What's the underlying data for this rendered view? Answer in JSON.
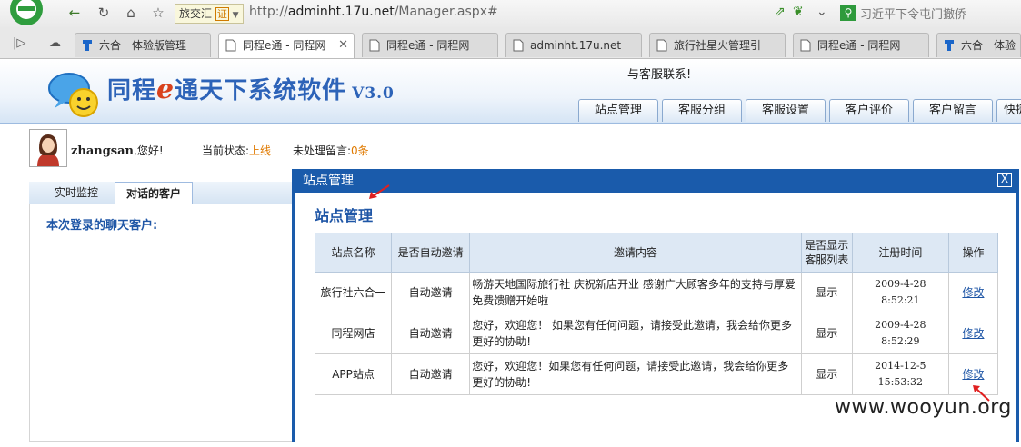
{
  "browser": {
    "tag_label": "旅交汇",
    "tag_badge": "证",
    "url_prefix": "http://",
    "url_host": "adminht.17u.net",
    "url_path": "/Manager.aspx#",
    "search_text": "习近平下令屯门撤侨",
    "tabs": [
      {
        "label": "六合一体验版管理"
      },
      {
        "label": "同程e通 - 同程网"
      },
      {
        "label": "同程e通 - 同程网"
      },
      {
        "label": "adminht.17u.net"
      },
      {
        "label": "旅行社星火管理引"
      },
      {
        "label": "同程e通 - 同程网"
      },
      {
        "label": "六合一体验"
      }
    ]
  },
  "app": {
    "title_prefix": "同程",
    "title_e": "e",
    "title_suffix": "通天下系统软件",
    "version": "V3.0",
    "contact": "与客服联系!",
    "nav": [
      "站点管理",
      "客服分组",
      "客服设置",
      "客户评价",
      "客户留言",
      "快捷"
    ]
  },
  "user": {
    "name": "zhangsan",
    "greeting": ",您好!",
    "status_label": "当前状态:",
    "status_value": "上线",
    "unread_label": "未处理留言:",
    "unread_value": "0条"
  },
  "left": {
    "tabs": [
      "实时监控",
      "对话的客户"
    ],
    "chat_title": "本次登录的聊天客户:"
  },
  "modal": {
    "title": "站点管理",
    "close": "X",
    "heading": "站点管理",
    "columns": [
      "站点名称",
      "是否自动邀请",
      "邀请内容",
      "是否显示客服列表",
      "注册时间",
      "操作"
    ],
    "rows": [
      {
        "name": "旅行社六合一",
        "auto": "自动邀请",
        "content": "畅游天地国际旅行社 庆祝新店开业 感谢广大顾客多年的支持与厚爱免费馈赠开始啦",
        "show": "显示",
        "date": "2009-4-28 8:52:21",
        "action": "修改"
      },
      {
        "name": "同程网店",
        "auto": "自动邀请",
        "content": "您好，欢迎您！ 如果您有任何问题，请接受此邀请，我会给你更多更好的协助!",
        "show": "显示",
        "date": "2009-4-28 8:52:29",
        "action": "修改"
      },
      {
        "name": "APP站点",
        "auto": "自动邀请",
        "content": "您好，欢迎您！如果您有任何问题，请接受此邀请，我会给你更多更好的协助!",
        "show": "显示",
        "date": "2014-12-5 15:53:32",
        "action": "修改"
      }
    ]
  },
  "watermark": "www.wooyun.org"
}
